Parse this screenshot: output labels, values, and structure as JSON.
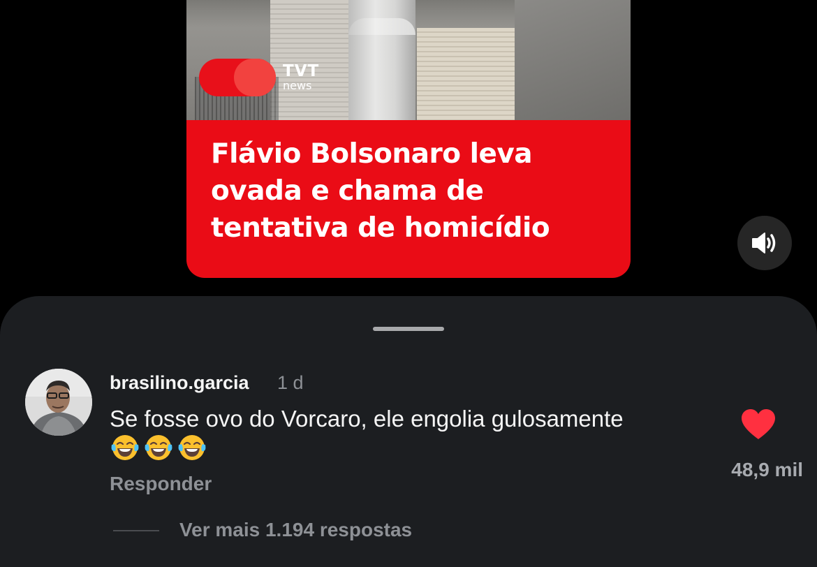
{
  "video": {
    "logo": {
      "line1": "TVT",
      "line2": "news"
    },
    "headline": "Flávio Bolsonaro leva ovada e chama de tentativa de homicídio",
    "sound_icon": "speaker-on-icon",
    "accent_color": "#ea0c16"
  },
  "comment": {
    "username": "brasilino.garcia",
    "time": "1 d",
    "text": "Se fosse ovo do Vorcaro, ele engolia gulosamente",
    "emojis": [
      "😂",
      "😂",
      "😂"
    ],
    "reply_label": "Responder",
    "like_icon": "heart-filled-icon",
    "like_color": "#ff3040",
    "likes": "48,9 mil",
    "more_replies_label": "Ver mais 1.194 respostas"
  }
}
